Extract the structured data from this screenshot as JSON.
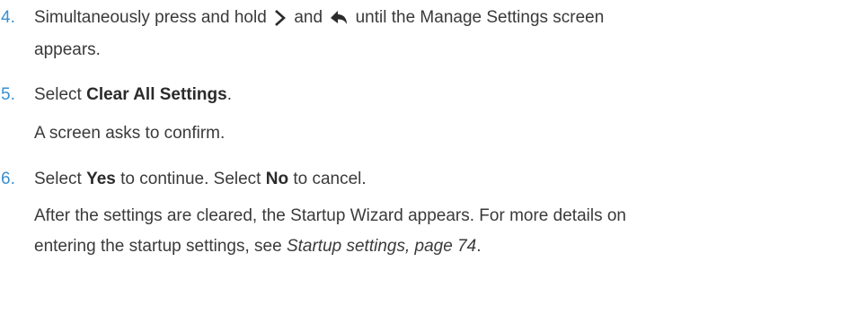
{
  "steps": [
    {
      "number": "4.",
      "line1_before": "Simultaneously press and hold",
      "line1_mid": "and",
      "line1_after": "until the Manage Settings screen",
      "line2": "appears.",
      "icon_1": "chevron-right-icon",
      "icon_2": "back-arrow-icon"
    },
    {
      "number": "5.",
      "text_before": "Select",
      "text_bold": "Clear All Settings",
      "text_after": ".",
      "sub": "A screen asks to confirm."
    },
    {
      "number": "6.",
      "text_before": "Select",
      "bold_1": "Yes",
      "text_mid": "to continue. Select",
      "bold_2": "No",
      "text_after": "to cancel.",
      "sub_line1": "After the settings are cleared, the Startup Wizard appears. For more details on",
      "sub_line2_before": "entering the startup settings, see",
      "sub_line2_link": "Startup settings, page 74",
      "sub_line2_after": "."
    }
  ],
  "colors": {
    "number": "#3a8fd0",
    "text": "#3a3a3a",
    "bold": "#2b2b2b"
  }
}
